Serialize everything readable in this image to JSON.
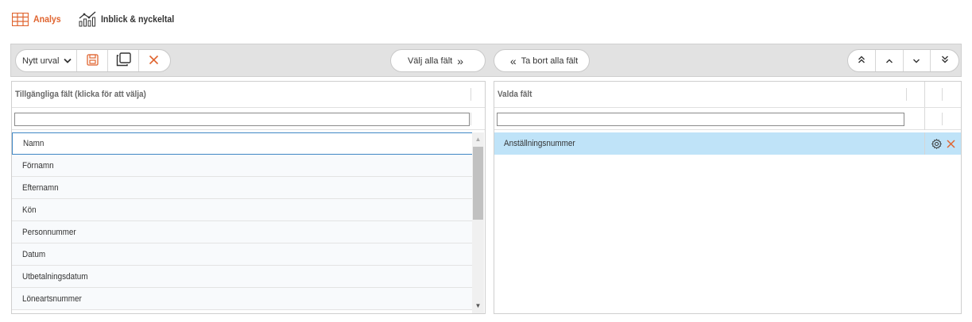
{
  "nav": {
    "analys_label": "Analys",
    "inblick_label": "Inblick & nyckeltal"
  },
  "toolbar": {
    "selection_value": "Nytt urval",
    "select_all_label": "Välj alla fält",
    "remove_all_label": "Ta bort alla fält"
  },
  "available": {
    "title": "Tillgängliga fält (klicka för att välja)",
    "filter_value": "",
    "items": [
      "Namn",
      "Förnamn",
      "Efternamn",
      "Kön",
      "Personnummer",
      "Datum",
      "Utbetalningsdatum",
      "Löneartsnummer"
    ]
  },
  "selected": {
    "title": "Valda fält",
    "filter_value": "",
    "items": [
      "Anställningsnummer"
    ]
  },
  "colors": {
    "accent": "#e06530",
    "selected_row": "#bfe3f8",
    "focus_border": "#3f87c4",
    "toolbar_bg": "#e2e2e2"
  },
  "icons": {
    "analys": "table-icon",
    "inblick": "chart-icon",
    "save": "save-icon",
    "copy": "copy-icon",
    "clear": "close-icon",
    "settings": "gear-icon",
    "remove": "close-icon"
  }
}
